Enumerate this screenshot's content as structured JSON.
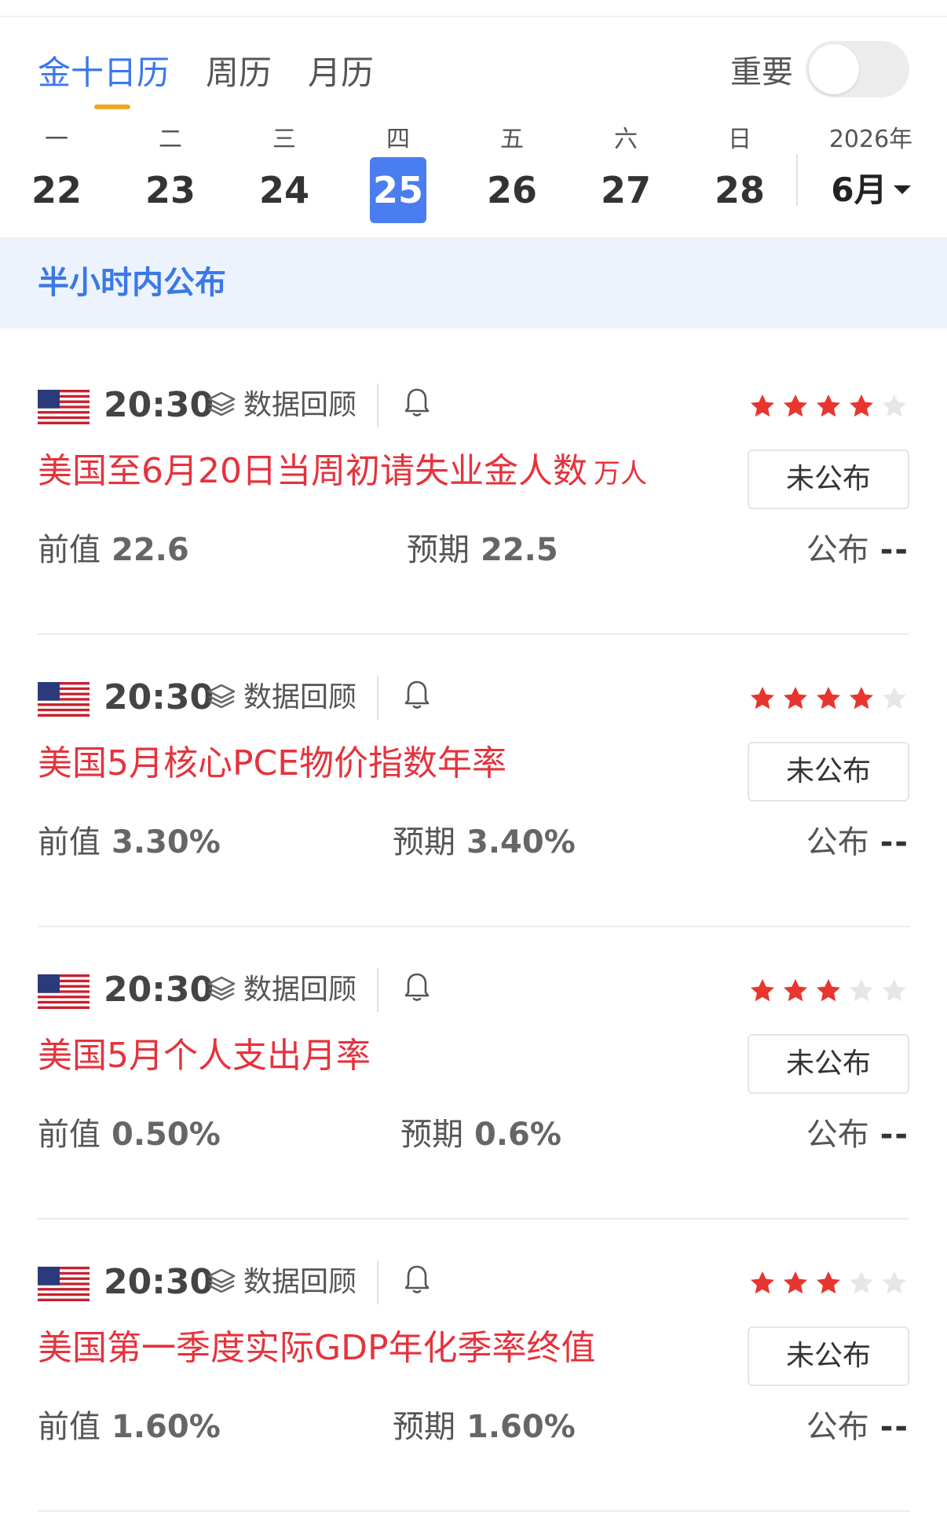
{
  "tabs": [
    {
      "label": "金十日历",
      "active": true
    },
    {
      "label": "周历",
      "active": false
    },
    {
      "label": "月历",
      "active": false
    }
  ],
  "important_toggle": {
    "label": "重要",
    "on": false
  },
  "week": [
    {
      "weekday": "一",
      "date": "22",
      "selected": false
    },
    {
      "weekday": "二",
      "date": "23",
      "selected": false
    },
    {
      "weekday": "三",
      "date": "24",
      "selected": false
    },
    {
      "weekday": "四",
      "date": "25",
      "selected": true
    },
    {
      "weekday": "五",
      "date": "26",
      "selected": false
    },
    {
      "weekday": "六",
      "date": "27",
      "selected": false
    },
    {
      "weekday": "日",
      "date": "28",
      "selected": false
    }
  ],
  "month_selector": {
    "year": "2026年",
    "month": "6月"
  },
  "banner": "半小时内公布",
  "colors": {
    "accent": "#3b78e7",
    "selected_day": "#4a7ef0",
    "title_red": "#e5333d",
    "star_on": "#e8352f",
    "star_off": "#e6e6e6",
    "tab_underline": "#f5a623"
  },
  "events": [
    {
      "flag": "us-flag-icon",
      "time": "20:30",
      "review_label": "数据回顾",
      "stars": 4,
      "max_stars": 5,
      "title": "美国至6月20日当周初请失业金人数",
      "unit": "万人",
      "status": "未公布",
      "prev_label": "前值",
      "prev_value": "22.6",
      "forecast_label": "预期",
      "forecast_value": "22.5",
      "actual_label": "公布",
      "actual_value": "--"
    },
    {
      "flag": "us-flag-icon",
      "time": "20:30",
      "review_label": "数据回顾",
      "stars": 4,
      "max_stars": 5,
      "title": "美国5月核心PCE物价指数年率",
      "unit": "",
      "status": "未公布",
      "prev_label": "前值",
      "prev_value": "3.30%",
      "forecast_label": "预期",
      "forecast_value": "3.40%",
      "actual_label": "公布",
      "actual_value": "--"
    },
    {
      "flag": "us-flag-icon",
      "time": "20:30",
      "review_label": "数据回顾",
      "stars": 3,
      "max_stars": 5,
      "title": "美国5月个人支出月率",
      "unit": "",
      "status": "未公布",
      "prev_label": "前值",
      "prev_value": "0.50%",
      "forecast_label": "预期",
      "forecast_value": "0.6%",
      "actual_label": "公布",
      "actual_value": "--"
    },
    {
      "flag": "us-flag-icon",
      "time": "20:30",
      "review_label": "数据回顾",
      "stars": 3,
      "max_stars": 5,
      "title": "美国第一季度实际GDP年化季率终值",
      "unit": "",
      "status": "未公布",
      "prev_label": "前值",
      "prev_value": "1.60%",
      "forecast_label": "预期",
      "forecast_value": "1.60%",
      "actual_label": "公布",
      "actual_value": "--"
    }
  ]
}
